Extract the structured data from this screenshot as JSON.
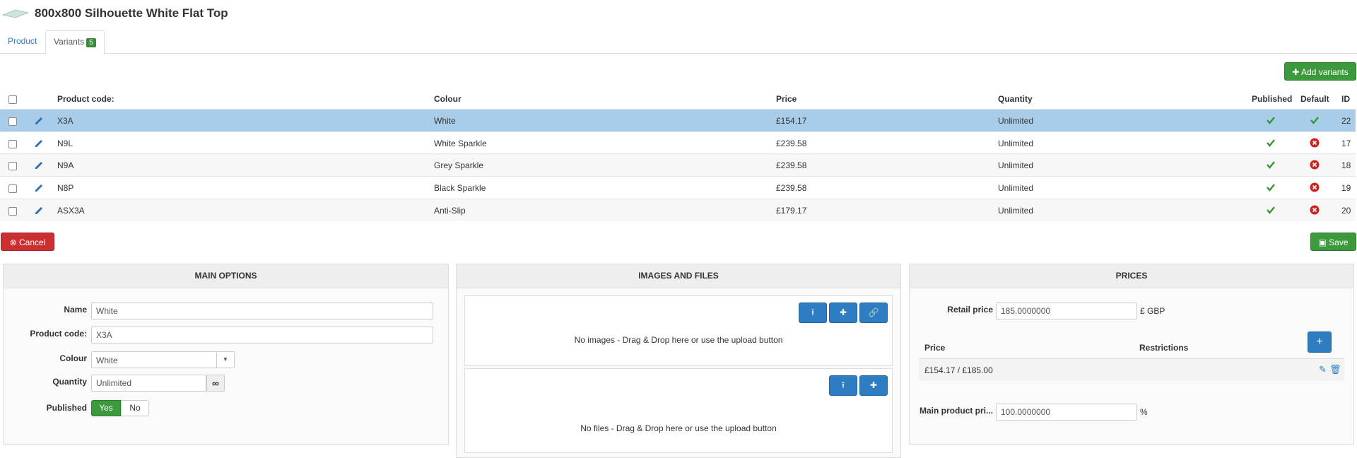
{
  "header": {
    "title": "800x800 Silhouette White Flat Top"
  },
  "tabs": [
    {
      "label": "Product"
    },
    {
      "label": "Variants",
      "badge": "5"
    }
  ],
  "toolbar": {
    "add_variants": "Add variants",
    "cancel": "Cancel",
    "save": "Save"
  },
  "table": {
    "columns": {
      "code": "Product code:",
      "colour": "Colour",
      "price": "Price",
      "quantity": "Quantity",
      "published": "Published",
      "default": "Default",
      "id": "ID"
    },
    "rows": [
      {
        "code": "X3A",
        "colour": "White",
        "price": "£154.17",
        "quantity": "Unlimited",
        "published": true,
        "default": true,
        "id": "22"
      },
      {
        "code": "N9L",
        "colour": "White Sparkle",
        "price": "£239.58",
        "quantity": "Unlimited",
        "published": true,
        "default": false,
        "id": "17"
      },
      {
        "code": "N9A",
        "colour": "Grey Sparkle",
        "price": "£239.58",
        "quantity": "Unlimited",
        "published": true,
        "default": false,
        "id": "18"
      },
      {
        "code": "N8P",
        "colour": "Black Sparkle",
        "price": "£239.58",
        "quantity": "Unlimited",
        "published": true,
        "default": false,
        "id": "19"
      },
      {
        "code": "ASX3A",
        "colour": "Anti-Slip",
        "price": "£179.17",
        "quantity": "Unlimited",
        "published": true,
        "default": false,
        "id": "20"
      }
    ]
  },
  "main_options": {
    "title": "MAIN OPTIONS",
    "name_label": "Name",
    "name_value": "White",
    "code_label": "Product code:",
    "code_value": "X3A",
    "colour_label": "Colour",
    "colour_value": "White",
    "quantity_label": "Quantity",
    "quantity_value": "Unlimited",
    "published_label": "Published",
    "yes": "Yes",
    "no": "No"
  },
  "images": {
    "title": "IMAGES AND FILES",
    "no_images": "No images - Drag & Drop here or use the upload button",
    "no_files": "No files - Drag & Drop here or use the upload button"
  },
  "prices": {
    "title": "PRICES",
    "retail_label": "Retail price",
    "retail_value": "185.0000000",
    "currency": "£ GBP",
    "col_price": "Price",
    "col_restrictions": "Restrictions",
    "price_row": "£154.17 / £185.00",
    "main_label": "Main product pri...",
    "main_value": "100.0000000",
    "percent": "%"
  },
  "colors": {
    "accent_green": "#3c9a3c",
    "accent_blue": "#2e7dc2",
    "danger": "#cc2f2f",
    "selected_row": "#a9cde9"
  }
}
